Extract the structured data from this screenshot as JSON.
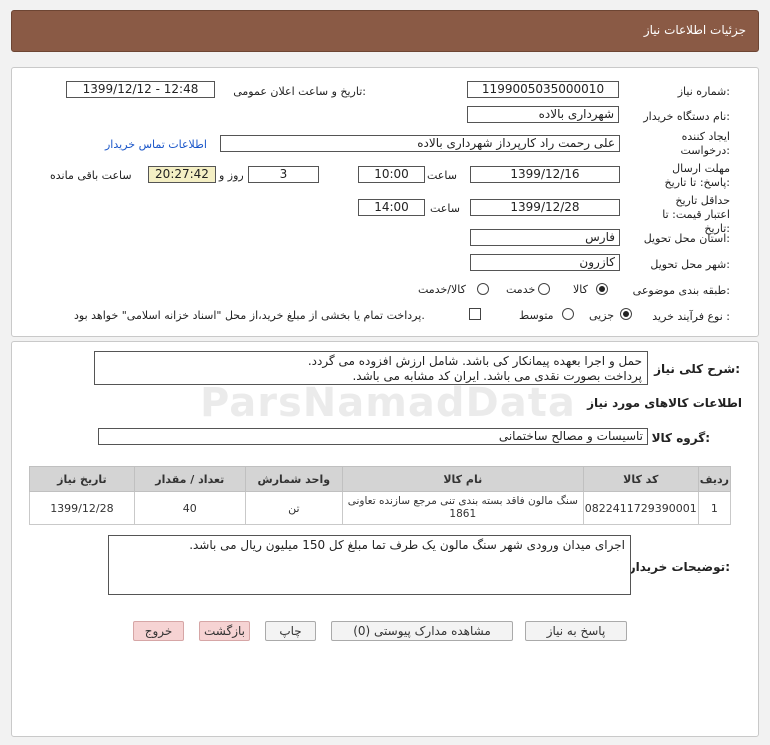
{
  "header": {
    "title": "جزئیات اطلاعات نیاز"
  },
  "need_number": {
    "label": "شماره نیاز:",
    "value": "1199005035000010"
  },
  "announce": {
    "label": "تاریخ و ساعت اعلان عمومی:",
    "value": "1399/12/12 - 12:48"
  },
  "buyer_org": {
    "label": "نام دستگاه خریدار:",
    "value": "شهرداری بالاده"
  },
  "creator": {
    "label": "ایجاد کننده درخواست:",
    "value": "علی رحمت راد کارپرداز شهرداری بالاده",
    "contact_link": "اطلاعات تماس خریدار"
  },
  "send_deadline": {
    "label": "مهلت ارسال پاسخ: تا تاریخ:",
    "date": "1399/12/16",
    "time_label": "ساعت",
    "time": "10:00",
    "days": "3",
    "days_label": "روز و",
    "remaining": "20:27:42",
    "remaining_label": "ساعت باقی مانده"
  },
  "validity": {
    "label": "حداقل تاریخ اعتبار قیمت: تا تاریخ:",
    "date": "1399/12/28",
    "time_label": "ساعت",
    "time": "14:00"
  },
  "province": {
    "label": "استان محل تحویل:",
    "value": "فارس"
  },
  "city": {
    "label": "شهر محل تحویل:",
    "value": "کازرون"
  },
  "category": {
    "label": "طبقه بندی موضوعی:",
    "options": [
      "کالا",
      "خدمت",
      "کالا/خدمت"
    ],
    "selected": "کالا"
  },
  "purchase_type": {
    "label": "نوع فرآیند خرید :",
    "options": [
      "جزیی",
      "متوسط"
    ],
    "selected": "جزیی",
    "payment_note": "پرداخت تمام یا بخشی از مبلغ خرید،از محل \"اسناد خزانه اسلامی\" خواهد بود."
  },
  "general_desc": {
    "label": "شرح کلی نیاز:",
    "line1": "حمل و اجرا بعهده پیمانکار کی باشد. شامل ارزش افزوده می گردد.",
    "line2": "پرداخت بصورت نقدی می باشد. ایران کد مشابه می باشد."
  },
  "goods_info": {
    "title": "اطلاعات کالاهای مورد نیاز"
  },
  "goods_group": {
    "label": "گروه کالا:",
    "value": "تاسیسات و مصالح ساختمانی"
  },
  "table": {
    "headers": [
      "ردیف",
      "کد کالا",
      "نام کالا",
      "واحد شمارش",
      "تعداد / مقدار",
      "تاریخ نیاز"
    ],
    "rows": [
      {
        "row": "1",
        "code": "0822411729390001",
        "name": "سنگ مالون فاقد بسته بندی تنی مرجع سازنده تعاونی 1861",
        "unit": "تن",
        "qty": "40",
        "date": "1399/12/28"
      }
    ]
  },
  "buyer_notes": {
    "label": "توضیحات خریدار:",
    "value": "اجرای میدان ورودی شهر سنگ مالون یک طرف تما مبلغ کل 150 میلیون ریال می باشد."
  },
  "buttons": {
    "reply": "پاسخ به نیاز",
    "attachments": "مشاهده مدارک پیوستی (0)",
    "print": "چاپ",
    "back": "بازگشت",
    "exit": "خروج"
  },
  "watermark": {
    "text": "ParsNamadData"
  },
  "colors": {
    "header_bg": "#8a5a45",
    "link": "#1a56c9",
    "remaining_bg": "#f4efc4",
    "exit_bg": "#f6d3d3"
  }
}
